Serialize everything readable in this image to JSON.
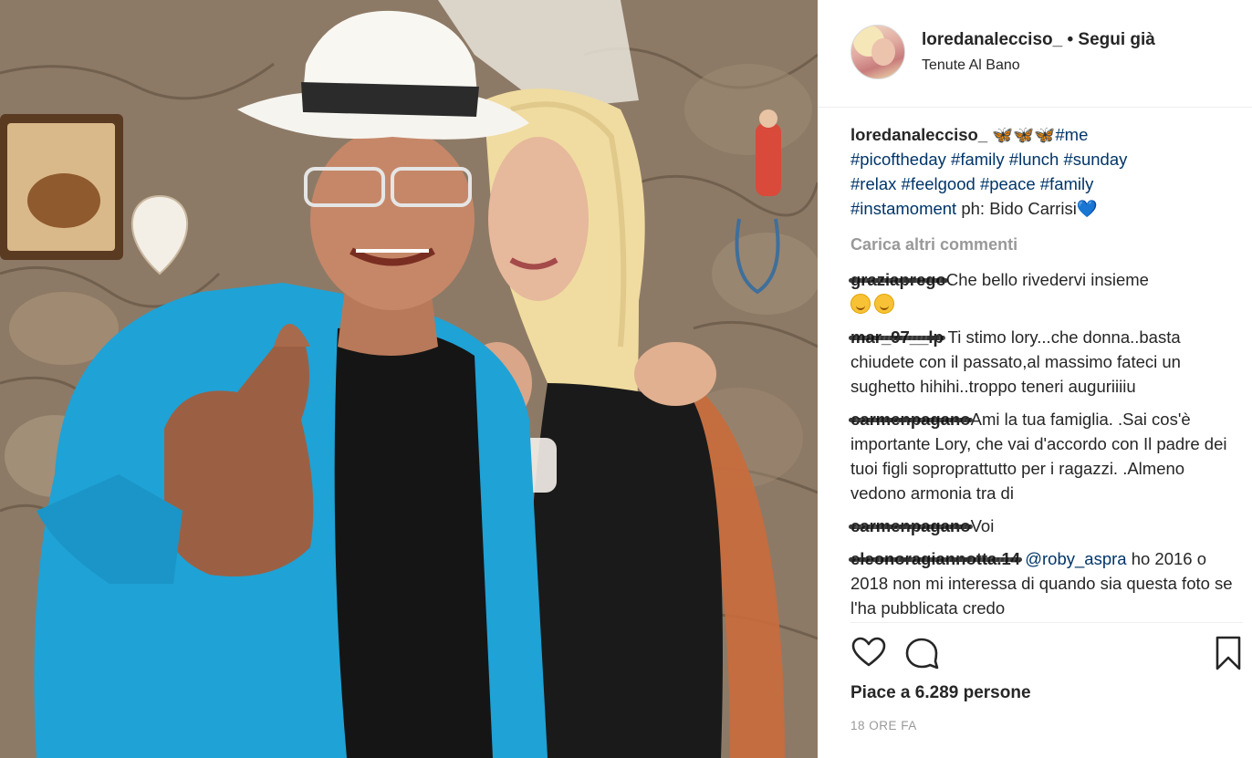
{
  "post": {
    "username": "loredanalecciso_",
    "follow_status": "• Segui già",
    "location": "Tenute Al Bano",
    "caption": {
      "user": "loredanalecciso_",
      "emojis": "🦋🦋🦋",
      "hashtags_line1": "#me",
      "hashtags_line2": "#picoftheday #family #lunch #sunday",
      "hashtags_line3": "#relax #feelgood #peace #family",
      "hashtags_line4": "#instamoment",
      "credit": "ph: Bido Carrisi",
      "credit_emoji": "💙"
    },
    "load_more": "Carica altri commenti",
    "comments": [
      {
        "user": "graziaprego",
        "text": "Che bello rivedervi insieme",
        "emoji_count": 2
      },
      {
        "user": "mar_97__lp",
        "text": "Ti stimo lory...che donna..basta chiudete con il passato,al massimo fateci un sughetto hihihi..troppo teneri auguriiiiu"
      },
      {
        "user": "carmenpagano",
        "text": "Ami la tua famiglia. .Sai cos'è importante Lory, che vai d'accordo con Il padre dei tuoi figli soproprattutto per i ragazzi. .Almeno vedono armonia tra di"
      },
      {
        "user": "carmenpagano",
        "text": "Voi"
      },
      {
        "user": "eleonoragiannotta.14",
        "mention": "@roby_aspra",
        "text": "ho 2016 o 2018 non mi interessa di quando sia questa foto se l'ha pubblicata credo"
      }
    ],
    "likes": "Piace a 6.289 persone",
    "time_ago": "18 ORE FA",
    "icons": {
      "like": "heart-outline-icon",
      "comment": "speech-bubble-icon",
      "save": "bookmark-icon"
    }
  }
}
